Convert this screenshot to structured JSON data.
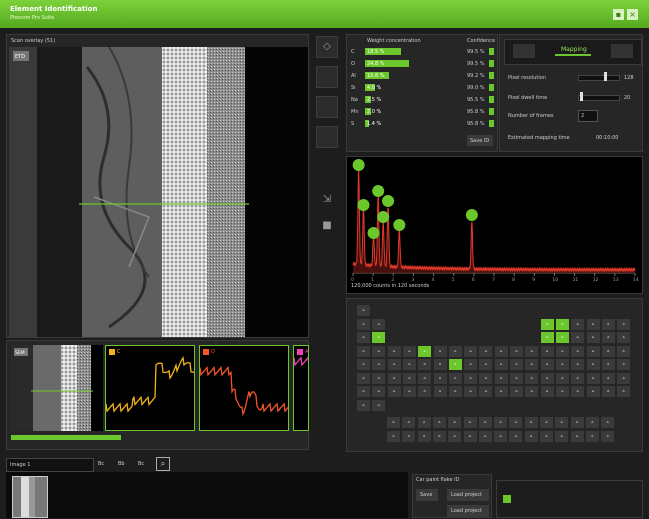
{
  "app": {
    "title": "Element Identification",
    "subtitle": "Phenom Pro Suite",
    "min_icon": "minimize-icon",
    "close_icon": "close-icon"
  },
  "image_panel": {
    "title": "Scan overlay (51)",
    "badge": "ETD"
  },
  "composition": {
    "header_name": "Weight concentration",
    "header_conf": "Confidence",
    "rows": [
      {
        "el": "C",
        "pct": "18.5 %",
        "fill": 0.45,
        "conf": "99.5 %"
      },
      {
        "el": "O",
        "pct": "24.8 %",
        "fill": 0.55,
        "conf": "99.5 %"
      },
      {
        "el": "Al",
        "pct": "15.8 %",
        "fill": 0.3,
        "conf": "99.2 %"
      },
      {
        "el": "Si",
        "pct": "4.0 %",
        "fill": 0.12,
        "conf": "99.0 %"
      },
      {
        "el": "Na",
        "pct": "2.5 %",
        "fill": 0.08,
        "conf": "95.5 %"
      },
      {
        "el": "Mn",
        "pct": "2.0 %",
        "fill": 0.07,
        "conf": "95.8 %"
      },
      {
        "el": "S",
        "pct": "1.4 %",
        "fill": 0.05,
        "conf": "95.8 %"
      }
    ],
    "button": "Save ID"
  },
  "settings": {
    "mode": "Mapping",
    "pixel_label": "Pixel resolution",
    "pixel_value": "128",
    "dwell_label": "Pixel dwell time",
    "dwell_value": "20",
    "frames_label": "Number of frames",
    "frames_value": "2",
    "est_label": "Estimated mapping time",
    "est_value": "00:10:00"
  },
  "spectrum": {
    "status": "120,000 counts in 120 seconds",
    "ticks": [
      "0",
      "1",
      "2",
      "3",
      "4",
      "5",
      "6",
      "7",
      "8",
      "9",
      "10",
      "11",
      "12",
      "13",
      "14"
    ]
  },
  "linescan": {
    "thumb_badge": "SEM",
    "channels": [
      {
        "name": "C",
        "color": "#f2b21c"
      },
      {
        "name": "O",
        "color": "#f2552a"
      },
      {
        "name": "Al",
        "color": "#ee3fb5"
      }
    ]
  },
  "bottom": {
    "image_name": "Image 1",
    "tool_labels": [
      "Bc",
      "Bb",
      "Bc"
    ],
    "project_title": "Car paint flake ID",
    "save": "Save",
    "load": "Load project",
    "load2": "Load project"
  },
  "colors": {
    "accent": "#6cc72c",
    "spectrum_line": "#e33a2a"
  }
}
